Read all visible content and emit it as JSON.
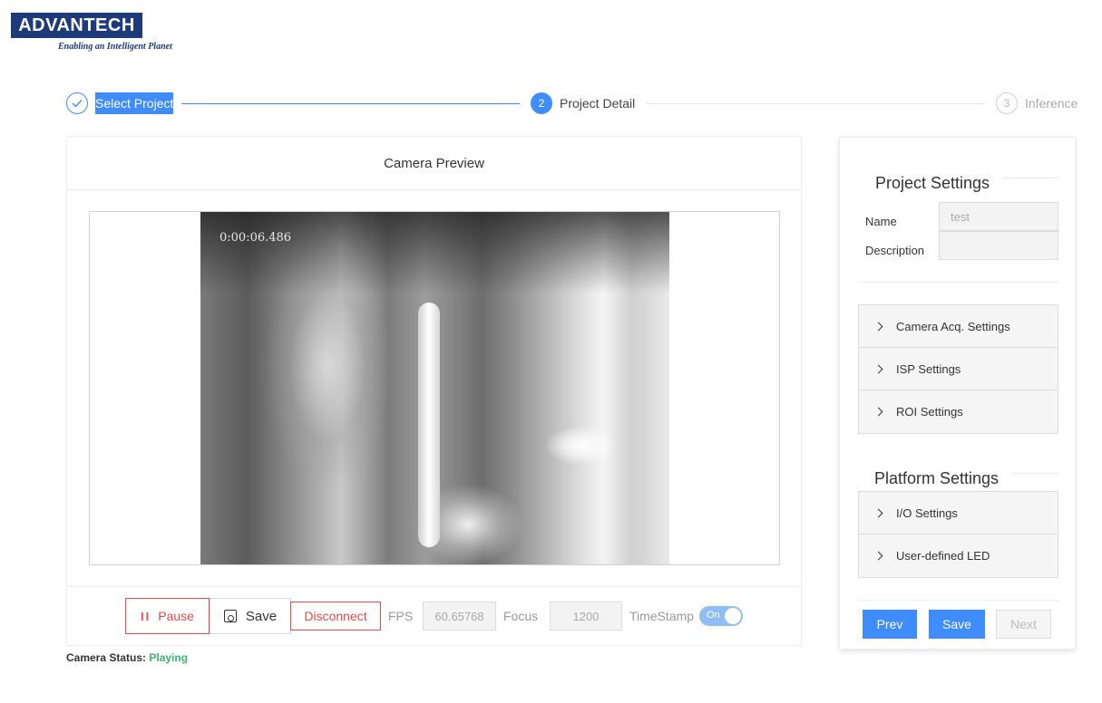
{
  "brand": {
    "logo_text": "ADVANTECH",
    "tagline": "Enabling an Intelligent Planet"
  },
  "stepper": {
    "steps": [
      {
        "number": "1",
        "label": "Select Project",
        "status": "finished"
      },
      {
        "number": "2",
        "label": "Project Detail",
        "status": "active"
      },
      {
        "number": "3",
        "label": "Inference",
        "status": "waiting"
      }
    ]
  },
  "camera": {
    "header": "Camera Preview",
    "timestamp": "0:00:06.486",
    "controls": {
      "pause_label": "Pause",
      "save_label": "Save",
      "disconnect_label": "Disconnect",
      "fps_label": "FPS",
      "fps_value": "60.65768",
      "focus_label": "Focus",
      "focus_value": "1200",
      "timestamp_label": "TimeStamp",
      "timestamp_toggle": "On"
    },
    "status_label": "Camera Status:",
    "status_value": "Playing"
  },
  "project_settings": {
    "title": "Project Settings",
    "name_label": "Name",
    "name_value": "test",
    "description_label": "Description",
    "description_value": "",
    "sections": [
      "Camera Acq. Settings",
      "ISP Settings",
      "ROI Settings"
    ]
  },
  "platform_settings": {
    "title": "Platform Settings",
    "sections": [
      "I/O Settings",
      "User-defined LED"
    ]
  },
  "navigation": {
    "prev_label": "Prev",
    "save_label": "Save",
    "next_label": "Next"
  },
  "colors": {
    "primary": "#3f8cff",
    "danger": "#e84a4a",
    "success": "#3cb371",
    "brand": "#1d3a7a"
  }
}
